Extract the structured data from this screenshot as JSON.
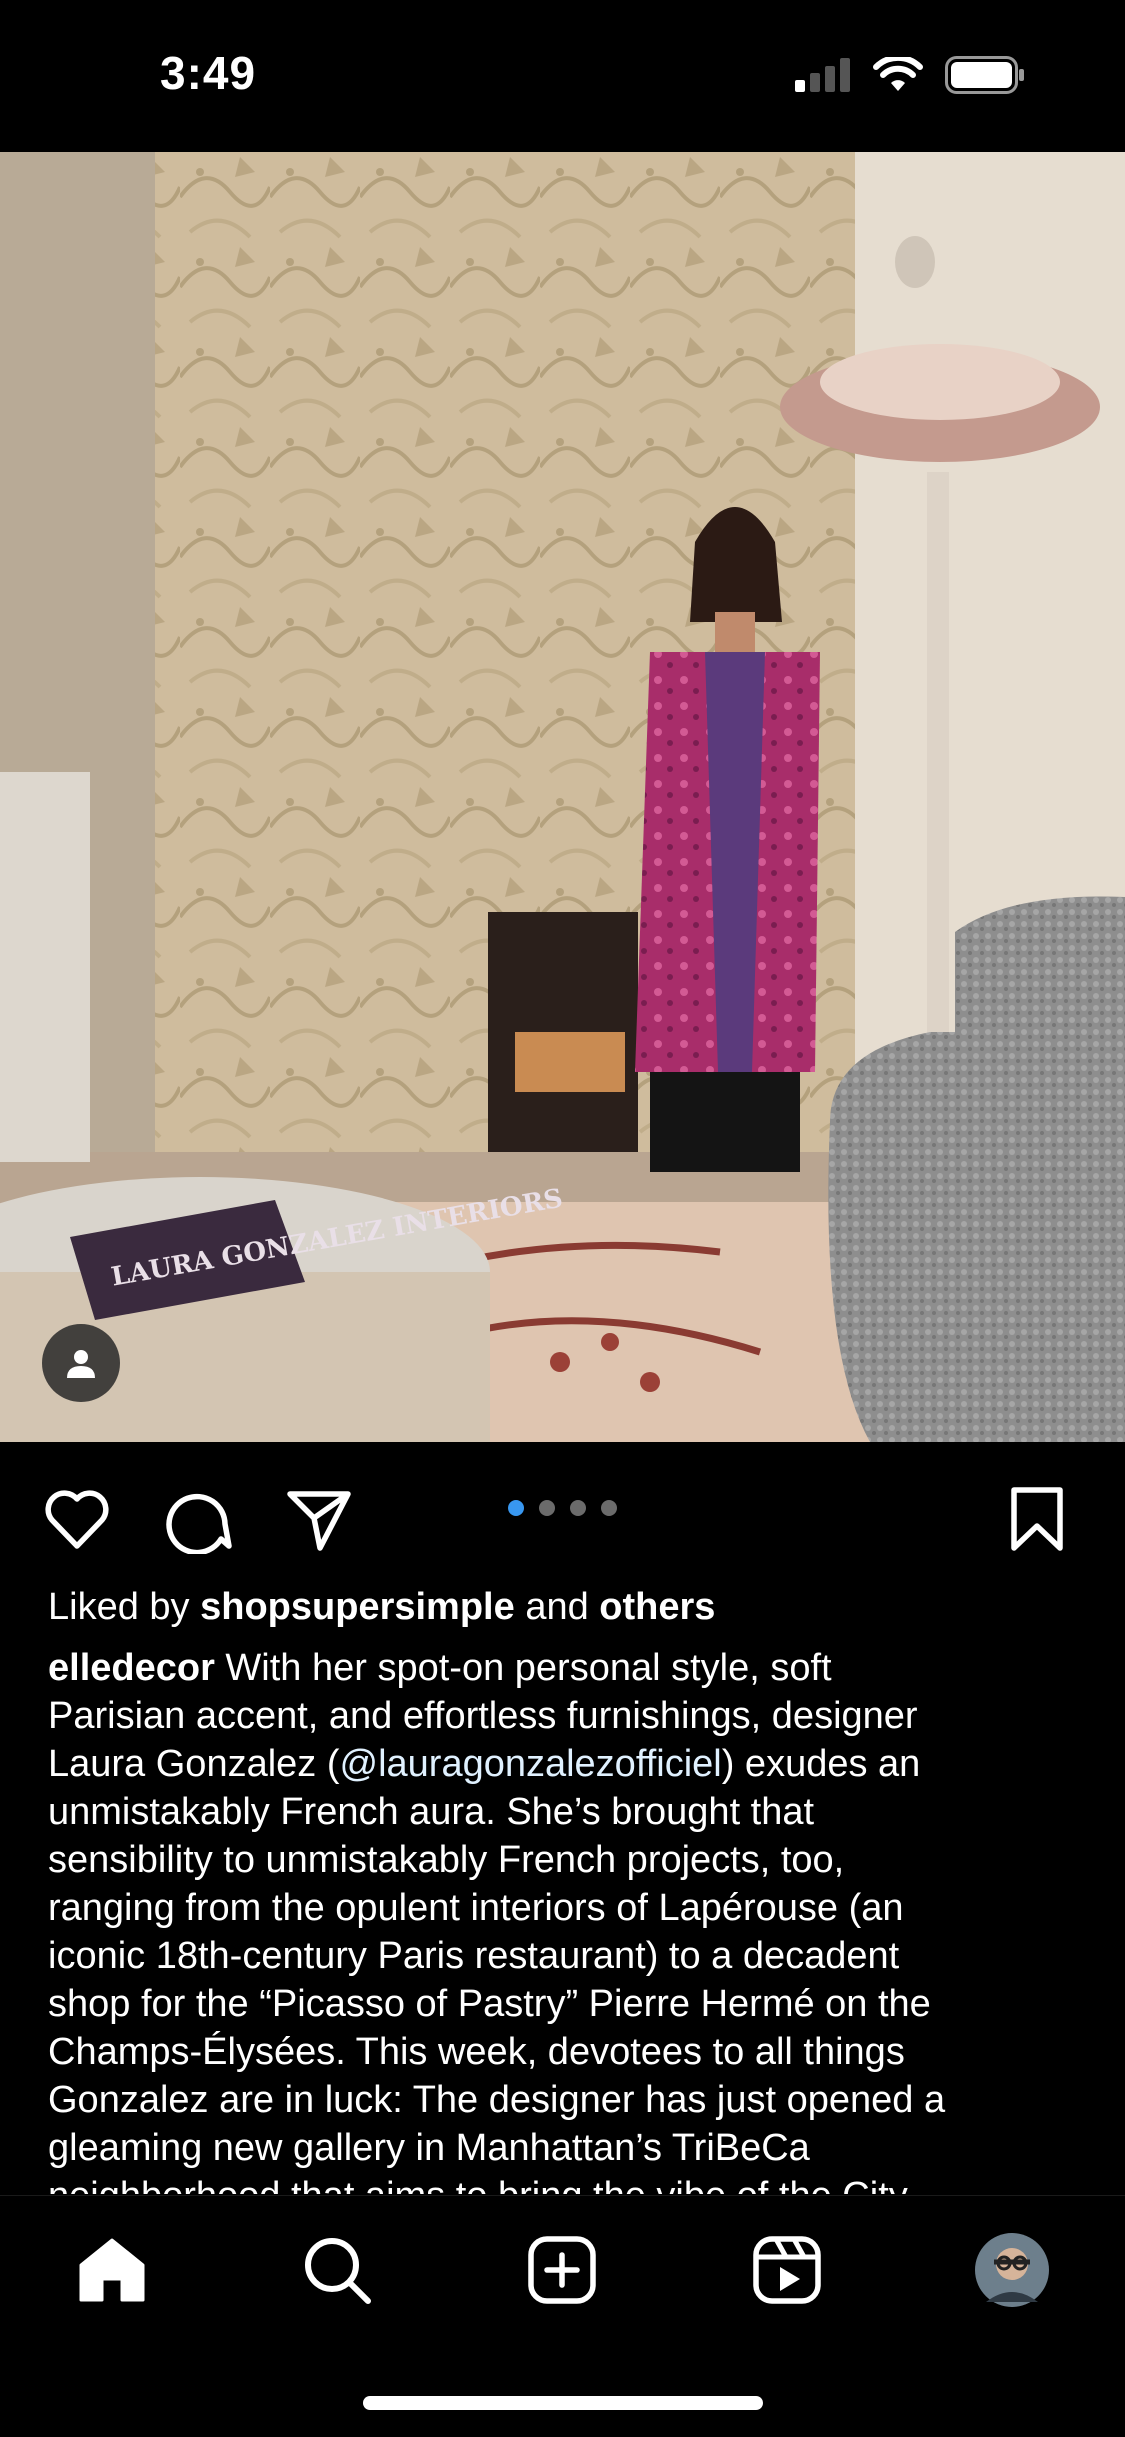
{
  "status_bar": {
    "time": "3:49"
  },
  "post": {
    "carousel": {
      "total": 4,
      "active_index": 0
    },
    "likes": {
      "prefix": "Liked by",
      "user": "shopsupersimple",
      "joiner": "and",
      "others": "others"
    },
    "caption": {
      "username": "elledecor",
      "line1_rest": " With her spot-on personal style, soft",
      "line2": "Parisian accent, and effortless furnishings, designer",
      "line3_before": "Laura Gonzalez (",
      "line3_mention": "@lauragonzalezofficiel",
      "line3_after": ") exudes an",
      "line4": "unmistakably French aura. She’s brought that",
      "line5": "sensibility to unmistakably French projects, too,",
      "line6": "ranging from the opulent interiors of Lapérouse (an",
      "line7": "iconic 18th-century Paris restaurant) to a decadent",
      "line8": "shop for the “Picasso of Pastry” Pierre Hermé on the",
      "line9": "Champs-Élysées. This week, devotees to all things",
      "line10": "Gonzalez are in luck: The designer has just opened a",
      "line11": "gleaming new gallery in Manhattan’s TriBeCa",
      "line12": "neighborhood that aims to bring the vibe of the City"
    },
    "book_cover_text": "LAURA GONZALEZ INTERIORS"
  },
  "icons": {
    "like": "heart-icon",
    "comment": "comment-icon",
    "share": "send-icon",
    "save": "bookmark-icon",
    "tag": "person-icon"
  },
  "tab_bar": {
    "items": [
      "home-icon",
      "search-icon",
      "create-icon",
      "reels-icon",
      "profile-avatar"
    ]
  },
  "colors": {
    "accent": "#3897f0",
    "background": "#000000"
  }
}
